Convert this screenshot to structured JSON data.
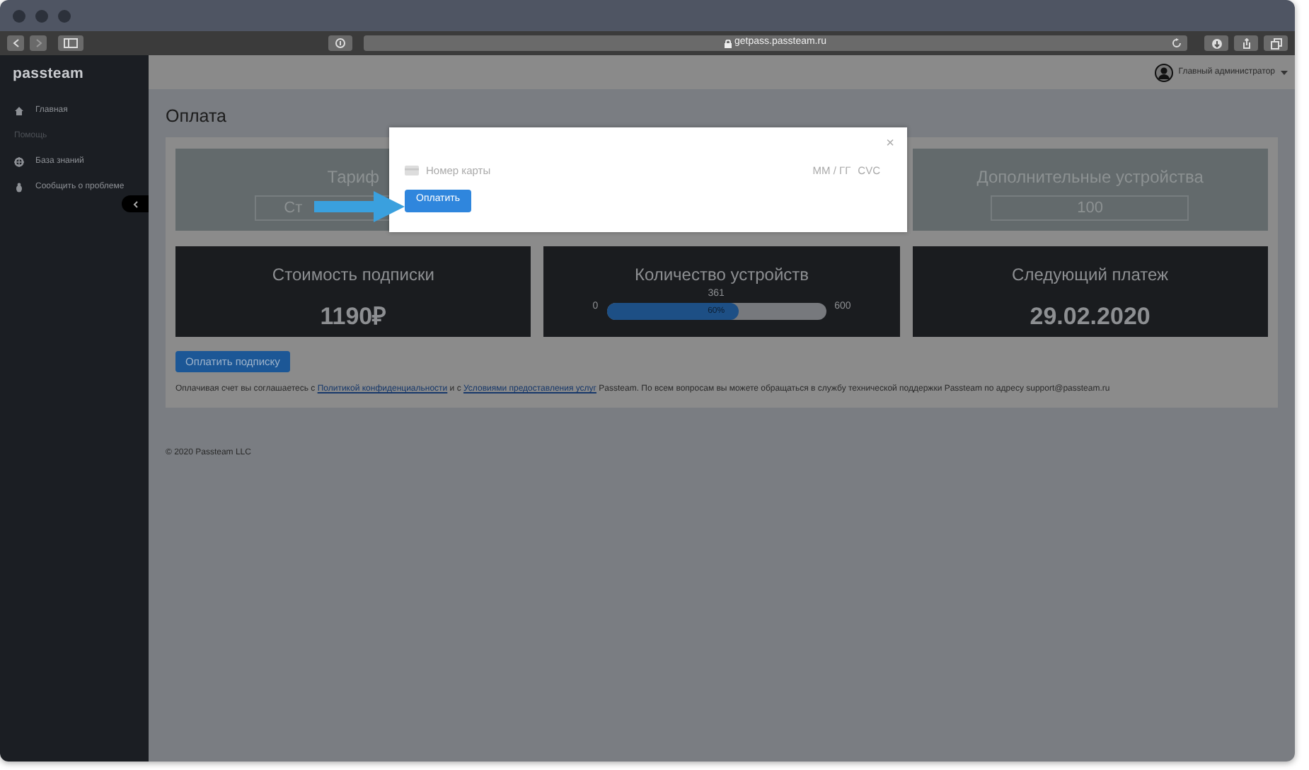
{
  "browser": {
    "url": "getpass.passteam.ru"
  },
  "sidebar": {
    "logo": "passteam",
    "items": [
      {
        "kind": "link",
        "label": "Главная"
      },
      {
        "kind": "section",
        "label": "Помощь"
      },
      {
        "kind": "link",
        "label": "База знаний"
      },
      {
        "kind": "link",
        "label": "Сообщить о проблеме"
      }
    ]
  },
  "header": {
    "user": "Главный администратор"
  },
  "page": {
    "title": "Оплата"
  },
  "top_cards": [
    {
      "title": "Тариф",
      "value": "Ст"
    },
    {
      "title": "Дополнительные устройства",
      "value": "100"
    }
  ],
  "stat_cards": [
    {
      "kind": "value",
      "title": "Стоимость подписки",
      "value": "1190₽"
    },
    {
      "kind": "progress",
      "title": "Количество устройств",
      "current": "361",
      "min": "0",
      "max": "600",
      "level": 0.6,
      "label": "60%"
    },
    {
      "kind": "value",
      "title": "Следующий платеж",
      "value": "29.02.2020"
    }
  ],
  "pay_button": "Оплатить подписку",
  "agreement": [
    {
      "text": "Оплачивая счет вы соглашаетесь с ",
      "link": false
    },
    {
      "text": "Политикой конфиденциальности",
      "link": true
    },
    {
      "text": " и с ",
      "link": false
    },
    {
      "text": "Условиями предоставления услуг",
      "link": true
    },
    {
      "text": " Passteam. По всем вопросам вы можете обращаться в службу технической поддержки Passteam по адресу support@passteam.ru",
      "link": false
    }
  ],
  "footer": "© 2020 Passteam LLC",
  "modal": {
    "close": "×",
    "card_placeholder": "Номер карты",
    "expiry_placeholder": "ММ / ГГ",
    "cvc_placeholder": "CVC",
    "button": "Оплатить"
  }
}
